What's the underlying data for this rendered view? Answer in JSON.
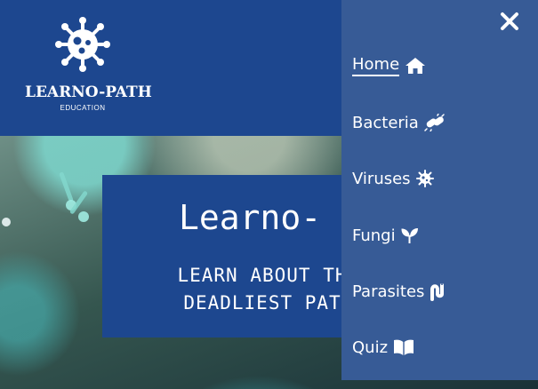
{
  "logo": {
    "name": "LEARNO-PATH",
    "tagline": "EDUCATION",
    "icon": "virus-icon"
  },
  "hero": {
    "title": "Learno-",
    "subtitle": "LEARN ABOUT TH\nDEADLIEST PAT"
  },
  "menu": {
    "close_icon": "close-icon",
    "items": [
      {
        "label": "Home",
        "icon": "home-icon",
        "active": true
      },
      {
        "label": "Bacteria",
        "icon": "bacteria-icon",
        "active": false
      },
      {
        "label": "Viruses",
        "icon": "virus-icon",
        "active": false
      },
      {
        "label": "Fungi",
        "icon": "seedling-icon",
        "active": false
      },
      {
        "label": "Parasites",
        "icon": "worm-icon",
        "active": false
      },
      {
        "label": "Quiz",
        "icon": "book-icon",
        "active": false
      }
    ]
  },
  "colors": {
    "header": "#1d478f",
    "menu": "#375b96",
    "text": "#ffffff"
  }
}
